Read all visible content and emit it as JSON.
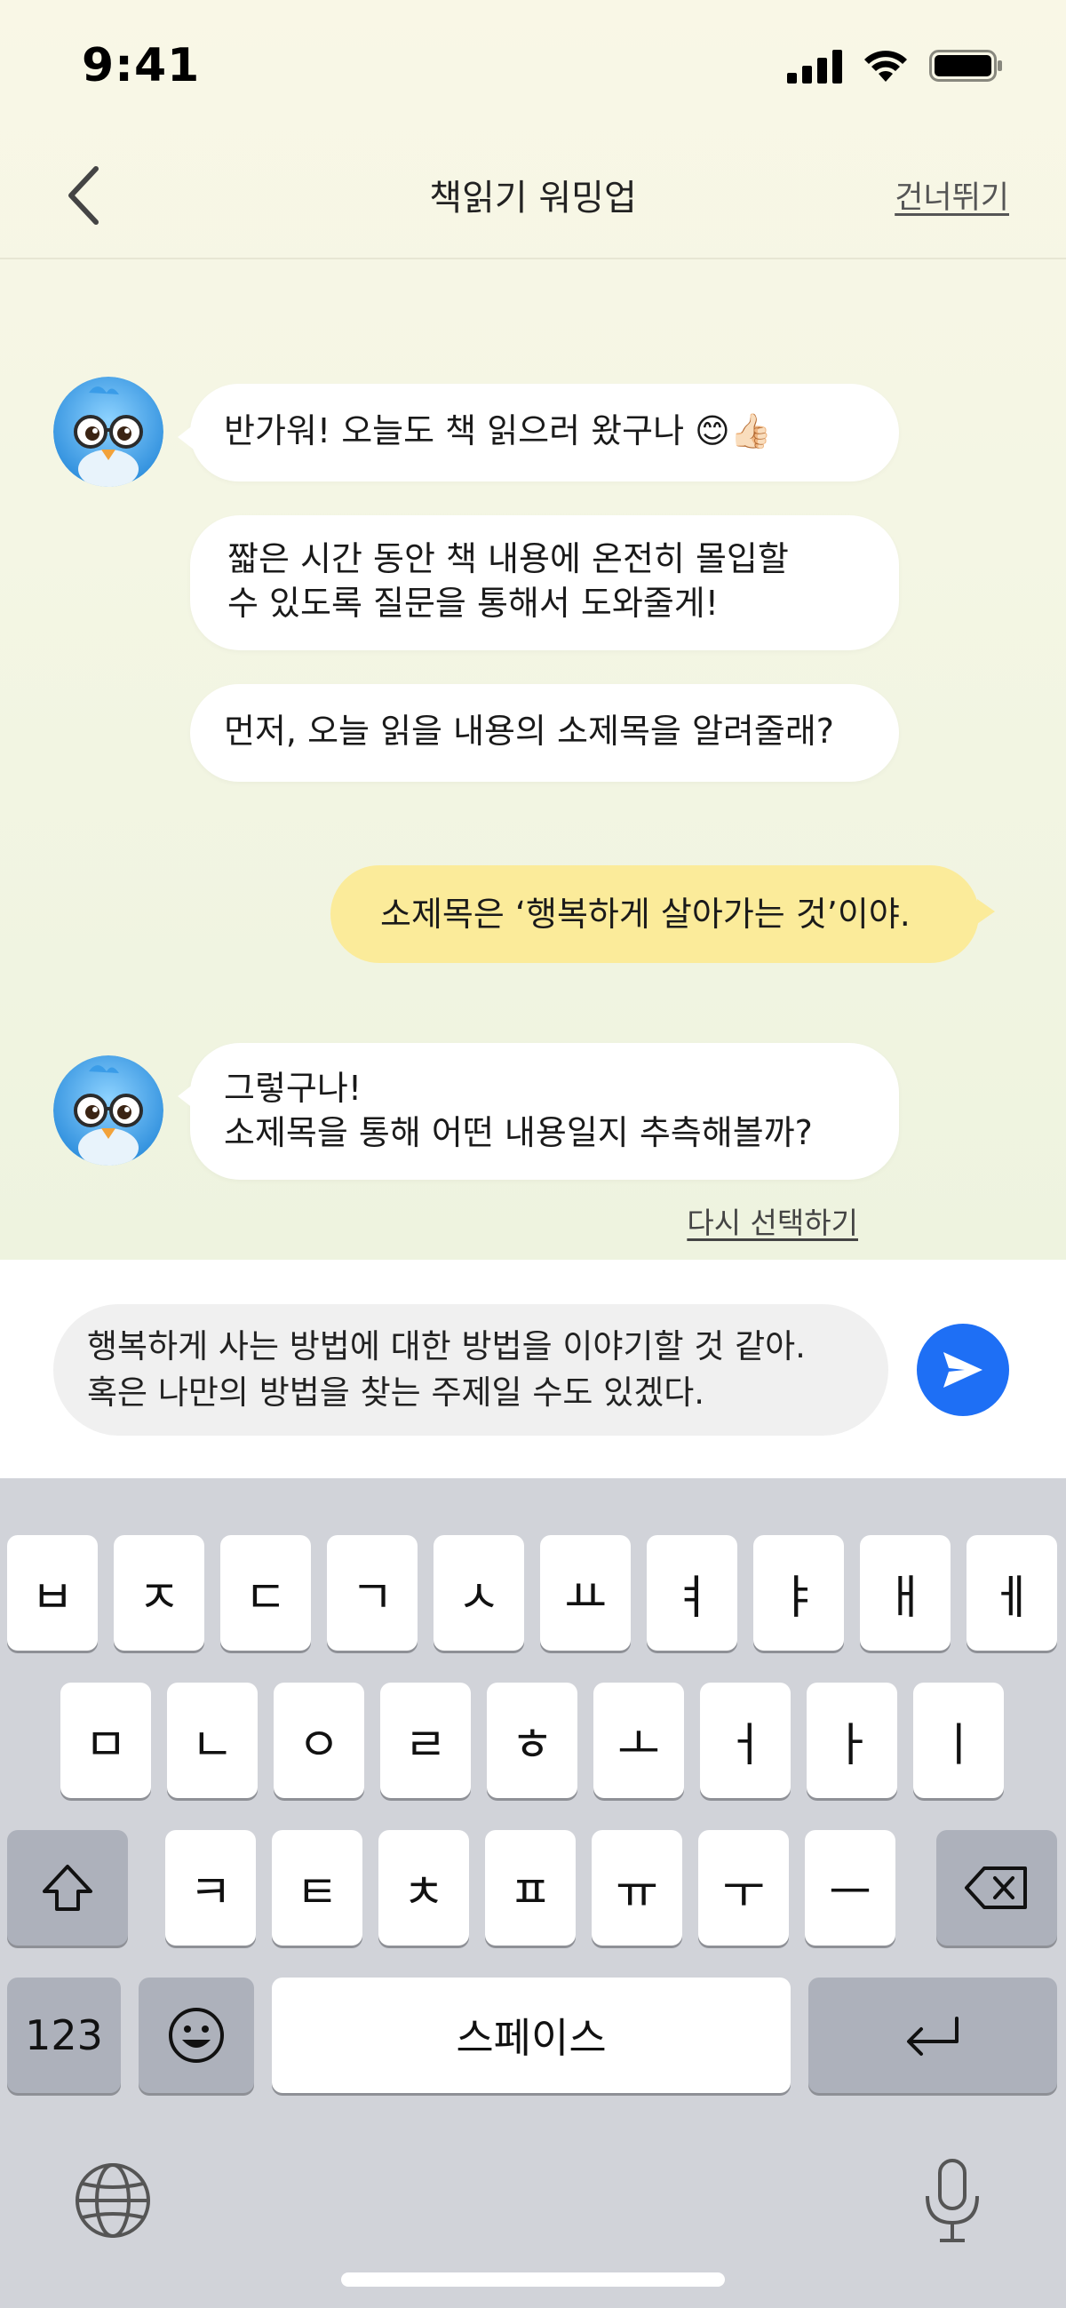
{
  "status": {
    "time": "9:41"
  },
  "nav": {
    "title": "책읽기 워밍업",
    "skip": "건너뛰기"
  },
  "chat": {
    "bot_1": [
      "반가워! 오늘도 책 읽으러 왔구나 😊👍🏻"
    ],
    "bot_2": [
      "짧은 시간 동안 책 내용에 온전히 몰입할",
      "수 있도록 질문을 통해서 도와줄게!"
    ],
    "bot_3": [
      "먼저, 오늘 읽을 내용의 소제목을 알려줄래?"
    ],
    "user_1": [
      "소제목은 ‘행복하게 살아가는 것’이야."
    ],
    "bot_4": [
      "그렇구나!",
      "소제목을 통해 어떤 내용일지 추측해볼까?"
    ],
    "reselect": "다시 선택하기"
  },
  "input": {
    "lines": [
      "행복하게 사는 방법에 대한 방법을 이야기할 것 같아.",
      "혹은 나만의 방법을 찾는 주제일 수도 있겠다."
    ]
  },
  "keyboard": {
    "row1": [
      "ㅂ",
      "ㅈ",
      "ㄷ",
      "ㄱ",
      "ㅅ",
      "ㅛ",
      "ㅕ",
      "ㅑ",
      "ㅐ",
      "ㅔ"
    ],
    "row2": [
      "ㅁ",
      "ㄴ",
      "ㅇ",
      "ㄹ",
      "ㅎ",
      "ㅗ",
      "ㅓ",
      "ㅏ",
      "ㅣ"
    ],
    "row3": [
      "ㅋ",
      "ㅌ",
      "ㅊ",
      "ㅍ",
      "ㅠ",
      "ㅜ",
      "ㅡ"
    ],
    "numbers": "123",
    "space": "스페이스"
  },
  "colors": {
    "accent": "#1e6ff5",
    "user_bubble": "#fbeb9a",
    "bot_bubble": "#ffffff",
    "keyboard_bg": "#d1d3d9"
  },
  "icons": [
    "back-chevron-icon",
    "bird-avatar-icon",
    "send-icon",
    "shift-icon",
    "delete-icon",
    "emoji-icon",
    "return-icon",
    "globe-icon",
    "microphone-icon",
    "signal-icon",
    "wifi-icon",
    "battery-icon"
  ]
}
